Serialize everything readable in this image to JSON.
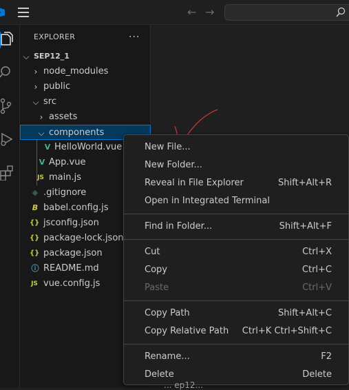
{
  "sidebar": {
    "header": "EXPLORER",
    "more_icon": "···",
    "tree": [
      {
        "label": "SEP12_1",
        "icon": "chevron-down",
        "level": 0,
        "root": true
      },
      {
        "label": "node_modules",
        "icon": "chevron-right",
        "level": 1
      },
      {
        "label": "public",
        "icon": "chevron-right",
        "level": 1
      },
      {
        "label": "src",
        "icon": "chevron-down",
        "level": 1
      },
      {
        "label": "assets",
        "icon": "chevron-right",
        "level": 2
      },
      {
        "label": "components",
        "icon": "chevron-down",
        "level": 2,
        "selected": true
      },
      {
        "label": "HelloWorld.vue",
        "icon": "vue",
        "level": 3
      },
      {
        "label": "App.vue",
        "icon": "vue",
        "level": 2
      },
      {
        "label": "main.js",
        "icon": "js",
        "level": 2
      },
      {
        "label": ".gitignore",
        "icon": "gitignore",
        "level": 1
      },
      {
        "label": "babel.config.js",
        "icon": "babel",
        "level": 1
      },
      {
        "label": "jsconfig.json",
        "icon": "json",
        "level": 1
      },
      {
        "label": "package-lock.json",
        "icon": "json",
        "level": 1
      },
      {
        "label": "package.json",
        "icon": "json",
        "level": 1
      },
      {
        "label": "README.md",
        "icon": "info",
        "level": 1
      },
      {
        "label": "vue.config.js",
        "icon": "js",
        "level": 1
      }
    ]
  },
  "context_menu": {
    "items": [
      {
        "label": "New File...",
        "shortcut": ""
      },
      {
        "label": "New Folder...",
        "shortcut": ""
      },
      {
        "label": "Reveal in File Explorer",
        "shortcut": "Shift+Alt+R"
      },
      {
        "label": "Open in Integrated Terminal",
        "shortcut": ""
      },
      {
        "label": "Find in Folder...",
        "shortcut": "Shift+Alt+F"
      },
      {
        "label": "Cut",
        "shortcut": "Ctrl+X"
      },
      {
        "label": "Copy",
        "shortcut": "Ctrl+C"
      },
      {
        "label": "Paste",
        "shortcut": "Ctrl+V",
        "disabled": true
      },
      {
        "label": "Copy Path",
        "shortcut": "Shift+Alt+C"
      },
      {
        "label": "Copy Relative Path",
        "shortcut": "Ctrl+K Ctrl+Shift+C"
      },
      {
        "label": "Rename...",
        "shortcut": "F2"
      },
      {
        "label": "Delete",
        "shortcut": "Delete"
      }
    ]
  },
  "editor": {
    "partial_text": "... ep12..."
  },
  "colors": {
    "accent": "#0078d4",
    "vue": "#41b883",
    "js": "#cbcb41",
    "json": "#cbcb41",
    "info": "#519aba",
    "annotation": "#c0392b"
  }
}
